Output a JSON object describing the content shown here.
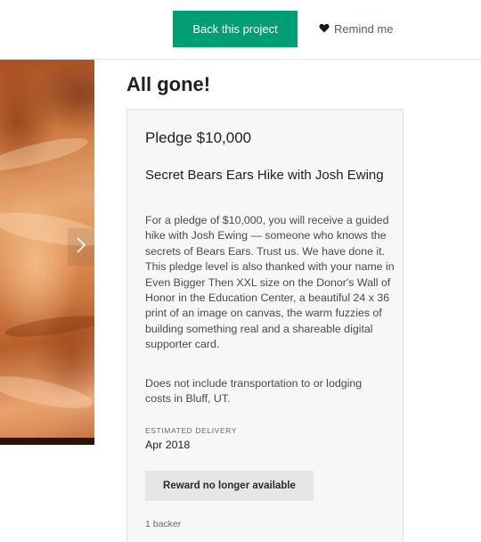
{
  "header": {
    "back_button_label": "Back this project",
    "remind_label": "Remind me"
  },
  "colors": {
    "primary_green": "#009e74",
    "card_background": "#f7f7f7"
  },
  "icons": {
    "remind": "heart-icon",
    "gallery_next": "chevron-right-icon"
  },
  "reward": {
    "status_heading": "All gone!",
    "pledge_amount": "Pledge $10,000",
    "title": "Secret Bears Ears Hike with Josh Ewing",
    "description": "For a pledge of $10,000, you will receive a guided hike with Josh Ewing — someone who knows the secrets of Bears Ears. Trust us. We have done it. This pledge level is also thanked with your name in Even Bigger Then XXL size on the Donor's Wall of Honor in the Education Center, a beautiful 24 x 36 print of an image on canvas, the warm fuzzies of building something real and a shareable digital supporter card.",
    "note": "Does not include transportation to or lodging costs in Bluff, UT.",
    "estimated_delivery_label": "ESTIMATED DELIVERY",
    "estimated_delivery_value": "Apr 2018",
    "unavailable_label": "Reward no longer available",
    "backers": "1 backer"
  }
}
